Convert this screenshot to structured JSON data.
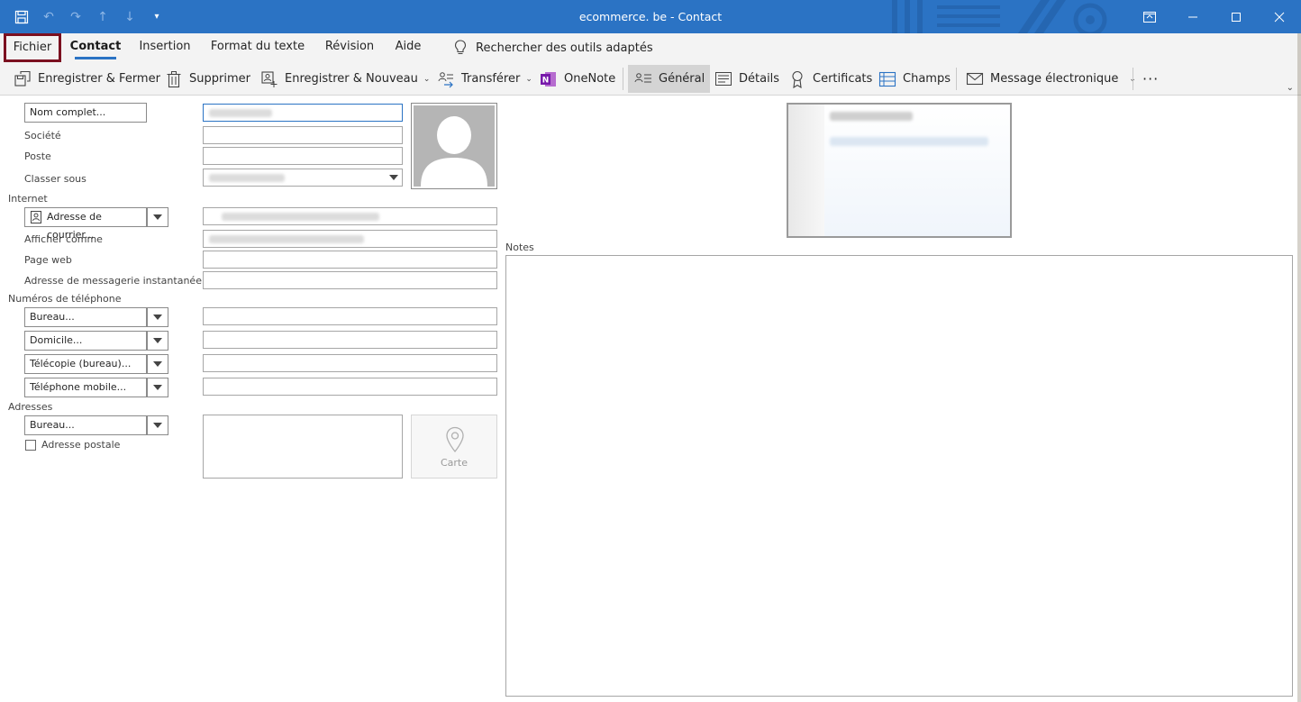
{
  "window": {
    "title": "ecommerce. be  -  Contact",
    "accent": "#2b73c4"
  },
  "qat": {
    "icons": [
      "save-icon",
      "undo-icon",
      "redo-icon",
      "up-arrow-icon",
      "down-arrow-icon",
      "customize-qat-icon"
    ]
  },
  "tabs": {
    "fichier": "Fichier",
    "contact": "Contact",
    "insertion": "Insertion",
    "format": "Format du texte",
    "revision": "Révision",
    "aide": "Aide",
    "search": "Rechercher des outils adaptés"
  },
  "ribbon": {
    "save_close": "Enregistrer & Fermer",
    "delete": "Supprimer",
    "save_new": "Enregistrer & Nouveau",
    "forward": "Transférer",
    "onenote": "OneNote",
    "general": "Général",
    "details": "Détails",
    "certificates": "Certificats",
    "fields": "Champs",
    "email": "Message électronique",
    "more": "···"
  },
  "form": {
    "full_name_btn": "Nom complet...",
    "company_lbl": "Société",
    "job_lbl": "Poste",
    "file_as_lbl": "Classer sous",
    "internet_group": "Internet",
    "email_btn": "Adresse de courrier...",
    "display_as_lbl": "Afficher comme",
    "webpage_lbl": "Page web",
    "im_lbl": "Adresse de messagerie instantanée",
    "phones_group": "Numéros de téléphone",
    "phone_office": "Bureau...",
    "phone_home": "Domicile...",
    "phone_fax": "Télécopie (bureau)...",
    "phone_mobile": "Téléphone mobile...",
    "addresses_group": "Adresses",
    "address_type": "Bureau...",
    "postal_lbl": "Adresse postale",
    "map_lbl": "Carte",
    "notes_lbl": "Notes"
  }
}
